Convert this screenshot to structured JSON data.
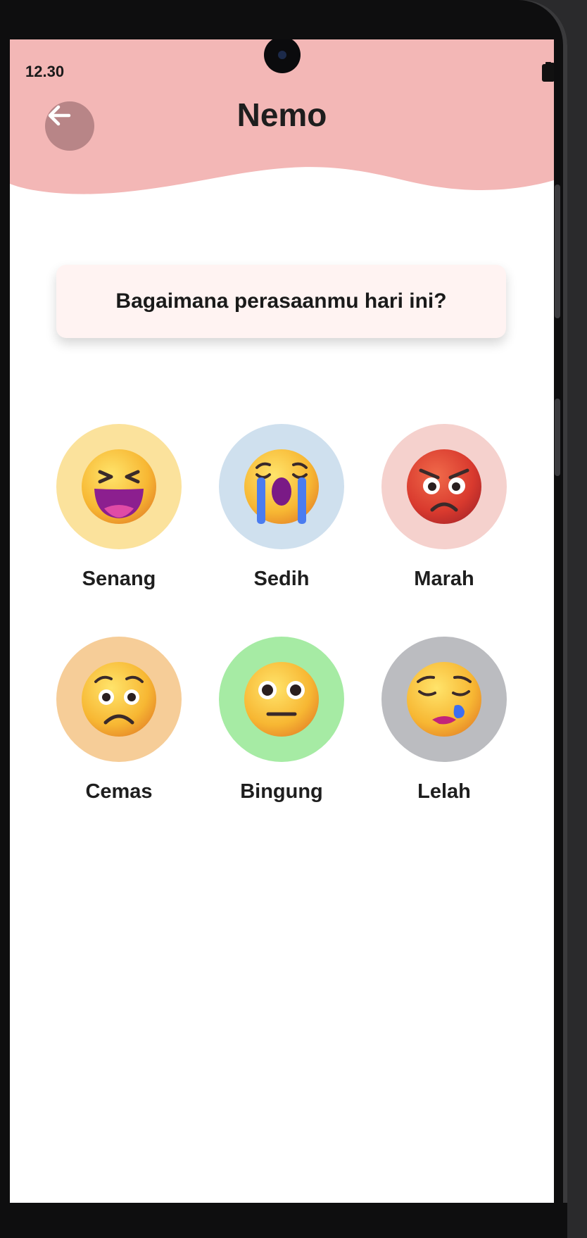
{
  "status_bar": {
    "time": "12.30",
    "icons": [
      "wifi-icon",
      "battery-icon"
    ]
  },
  "header": {
    "title": "Nemo",
    "back_icon": "arrow-left-icon",
    "color": "#f3b7b6"
  },
  "question": "Bagaimana perasaanmu hari ini?",
  "moods": [
    {
      "label": "Senang",
      "icon": "grinning-squinting-face-icon",
      "color": "#fbe29c"
    },
    {
      "label": "Sedih",
      "icon": "loudly-crying-face-icon",
      "color": "#cfe0ee"
    },
    {
      "label": "Marah",
      "icon": "angry-face-icon",
      "color": "#f5d1cd"
    },
    {
      "label": "Cemas",
      "icon": "worried-face-icon",
      "color": "#f6cd98"
    },
    {
      "label": "Bingung",
      "icon": "neutral-face-icon",
      "color": "#a6eba4"
    },
    {
      "label": "Lelah",
      "icon": "sleepy-face-icon",
      "color": "#bbbcc0"
    }
  ]
}
